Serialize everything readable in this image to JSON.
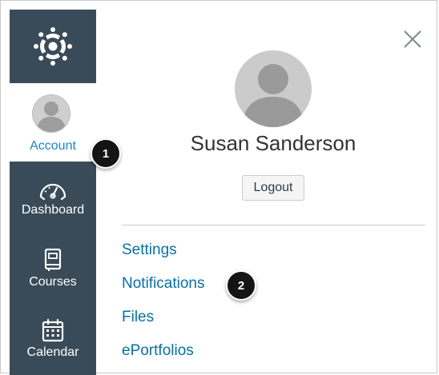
{
  "sidebar": {
    "logo_icon": "canvas-logo-icon",
    "account_label": "Account",
    "items": [
      {
        "label": "Dashboard",
        "icon": "speedometer-icon"
      },
      {
        "label": "Courses",
        "icon": "book-icon"
      },
      {
        "label": "Calendar",
        "icon": "calendar-icon"
      }
    ],
    "colors": {
      "background": "#394b58",
      "active_text": "#1a86c8"
    }
  },
  "tray": {
    "close_icon": "close-icon",
    "user_name": "Susan Sanderson",
    "logout_label": "Logout",
    "links": [
      {
        "label": "Settings"
      },
      {
        "label": "Notifications"
      },
      {
        "label": "Files"
      },
      {
        "label": "ePortfolios"
      }
    ],
    "colors": {
      "link": "#0770a3"
    }
  },
  "callouts": [
    {
      "label": "1"
    },
    {
      "label": "2"
    }
  ]
}
